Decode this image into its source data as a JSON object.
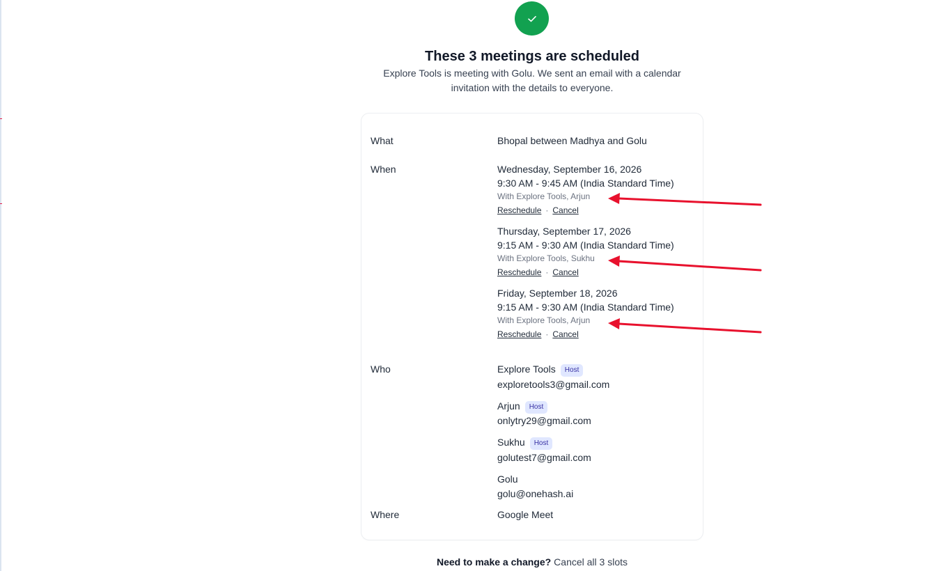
{
  "header": {
    "title": "These 3 meetings are scheduled",
    "subtitle_line1": "Explore Tools is meeting with Golu. We sent an email with a calendar",
    "subtitle_line2": "invitation with the details to everyone."
  },
  "labels": {
    "what": "What",
    "when": "When",
    "who": "Who",
    "where": "Where"
  },
  "what": "Bhopal between Madhya and Golu",
  "meetings": [
    {
      "date": "Wednesday, September 16, 2026",
      "time": "9:30 AM - 9:45 AM (India Standard Time)",
      "with": "With Explore Tools, Arjun",
      "reschedule": "Reschedule",
      "separator": "·",
      "cancel": "Cancel"
    },
    {
      "date": "Thursday, September 17, 2026",
      "time": "9:15 AM - 9:30 AM (India Standard Time)",
      "with": "With Explore Tools, Sukhu",
      "reschedule": "Reschedule",
      "separator": "·",
      "cancel": "Cancel"
    },
    {
      "date": "Friday, September 18, 2026",
      "time": "9:15 AM - 9:30 AM (India Standard Time)",
      "with": "With Explore Tools, Arjun",
      "reschedule": "Reschedule",
      "separator": "·",
      "cancel": "Cancel"
    }
  ],
  "who": [
    {
      "name": "Explore Tools",
      "badge": "Host",
      "email": "exploretools3@gmail.com"
    },
    {
      "name": "Arjun",
      "badge": "Host",
      "email": "onlytry29@gmail.com"
    },
    {
      "name": "Sukhu",
      "badge": "Host",
      "email": "golutest7@gmail.com"
    },
    {
      "name": "Golu",
      "email": "golu@onehash.ai"
    }
  ],
  "where": "Google Meet",
  "footer": {
    "question": "Need to make a change?",
    "cancel_all": "Cancel all 3 slots"
  },
  "colors": {
    "success": "#12a150",
    "badge_bg": "#e0e7ff",
    "badge_text": "#3730a3",
    "annotation_arrow": "#e8112d"
  },
  "icons": {
    "success": "check-icon"
  }
}
